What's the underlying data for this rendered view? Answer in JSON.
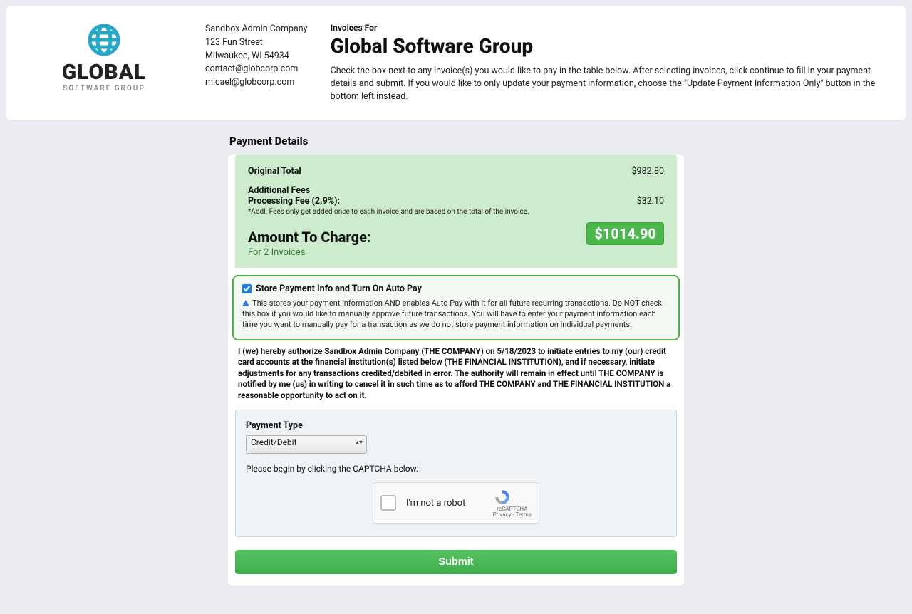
{
  "header": {
    "logo_text": "GLOBAL",
    "logo_subtext": "SOFTWARE GROUP",
    "company": {
      "name": "Sandbox Admin Company",
      "address": "123 Fun Street",
      "citystate": "Milwaukee, WI 54934",
      "email1": "contact@globcorp.com",
      "email2": "micael@globcorp.com"
    },
    "invoices_for_label": "Invoices For",
    "invoices_for_title": "Global Software Group",
    "invoices_for_desc": "Check the box next to any invoice(s) you would like to pay in the table below. After selecting invoices, click continue to fill in your payment details and submit. If you would like to only update your payment information, choose the \"Update Payment Information Only\" button in the bottom left instead."
  },
  "payment": {
    "section_title": "Payment Details",
    "original_total_label": "Original Total",
    "original_total_value": "$982.80",
    "additional_fees_label": "Additional Fees",
    "processing_fee_label": "Processing Fee (2.9%):",
    "processing_fee_value": "$32.10",
    "fee_note": "*Addl. Fees only get added once to each invoice and are based on the total of the invoice.",
    "amount_label": "Amount To Charge:",
    "amount_value": "$1014.90",
    "for_invoices": "For 2 Invoices",
    "autopay_label": "Store Payment Info and Turn On Auto Pay",
    "autopay_desc": "This stores your payment information AND enables Auto Pay with it for all future recurring transactions. Do NOT check this box if you would like to manually approve future transactions. You will have to enter your payment information each time you want to manually pay for a transaction as we do not store payment information on individual payments.",
    "auth_text": "I (we) hereby authorize Sandbox Admin Company (THE COMPANY) on 5/18/2023 to initiate entries to my (our) credit card accounts at the financial institution(s) listed below (THE FINANCIAL INSTITUTION), and if necessary, initiate adjustments for any transactions credited/debited in error. The authority will remain in effect until THE COMPANY is notified by me (us) in writing to cancel it in such time as to afford THE COMPANY and THE FINANCIAL INSTITUTION a reasonable opportunity to act on it.",
    "payment_type_label": "Payment Type",
    "payment_type_value": "Credit/Debit",
    "captcha_hint": "Please begin by clicking the CAPTCHA below.",
    "recaptcha_text": "I'm not a robot",
    "recaptcha_sub1": "reCAPTCHA",
    "recaptcha_sub2": "Privacy - Terms",
    "submit_label": "Submit"
  }
}
